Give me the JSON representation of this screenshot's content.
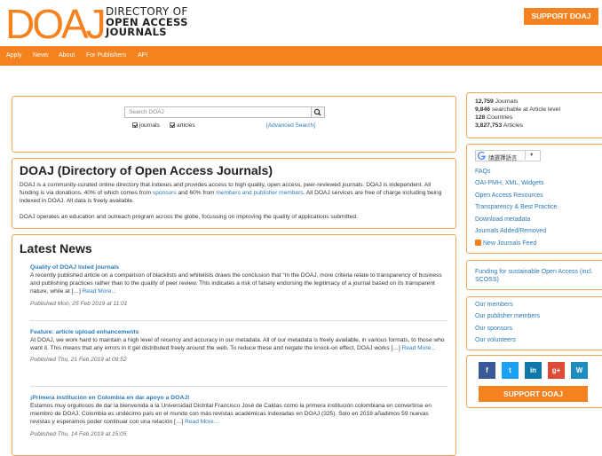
{
  "header": {
    "logo_mark": "DOAJ",
    "logo_line1": "DIRECTORY OF",
    "logo_line2": "OPEN ACCESS",
    "logo_line3": "JOURNALS",
    "support_label": "SUPPORT DOAJ"
  },
  "nav": [
    "Apply",
    "News",
    "About",
    "For Publishers",
    "API"
  ],
  "search": {
    "placeholder": "Search DOAJ",
    "journals_label": "journals",
    "articles_label": "articles",
    "advanced_label": "[Advanced Search]"
  },
  "intro": {
    "title": "DOAJ (Directory of Open Access Journals)",
    "p1_a": "DOAJ is a community-curated online directory that indexes and provides access to high quality, open access, peer-reviewed journals. DOAJ is independent. All funding is via donations, 40% of which comes from ",
    "p1_link1": "sponsors",
    "p1_b": " and 60% from ",
    "p1_link2": "members and publisher members",
    "p1_c": ". All DOAJ services are free of charge including being indexed in DOAJ. All data is freely available.",
    "p2": "DOAJ operates an education and outreach program across the globe, focussing on improving the quality of applications submitted."
  },
  "news": {
    "heading": "Latest News",
    "items": [
      {
        "title": "Quality of DOAJ listed journals",
        "body": "A recently published article on a comparison of blacklists and whitelists draws the conclusion that “In the DOAJ, more criteria relate to transparency of business and publishing practices rather than to the quality of peer review. This indicates a risk of falsely endorsing the legitimacy of a journal based on its transparent nature, while at […] ",
        "more": "Read More...",
        "published": "Published Mon, 25 Feb 2019 at 11:01"
      },
      {
        "title": "Feature: article upload enhancements",
        "body": "At DOAJ, we work hard to maintain a high level of recency and accuracy in our metadata. All of our metadata is freely available, in various formats, to those who want it. This means that any errors in it get distributed freely around the web. To reduce these and negate the knock-on effect, DOAJ works […] ",
        "more": "Read More...",
        "published": "Published Thu, 21 Feb 2019 at 09:52"
      },
      {
        "title": "¡Primera institución en Colombia en dar apoyo a DOAJ!",
        "body": "Estamos muy orgullosos de dar la bienvenida a la Universidad Distrital Francisco José de Caldas como la primera institución colombiana en convertirse en miembro de DOAJ. Colombia es undécimo país en el mundo con más revistas académicas indexadas en DOAJ (325). Solo en 2018 añadimos 59 nuevas revistas y esperamos poder continuar con una relación […] ",
        "more": "Read More...",
        "published": "Published Thu, 14 Feb 2019 at 15:05"
      }
    ]
  },
  "stats": {
    "journals_num": "12,759",
    "journals_label": " Journals",
    "searchable_num": "9,846",
    "searchable_label": " searchable at Article level",
    "countries_num": "128",
    "countries_label": " Countries",
    "articles_num": "3,827,753",
    "articles_label": " Articles"
  },
  "translate": {
    "label": "請選擇語言",
    "arrow": "▼",
    "icon": "google-g-icon"
  },
  "links": [
    "FAQs",
    "OAI-PMH, XML, Widgets",
    "Open Access Resources",
    "Transparency & Best Practice",
    "Download metadata",
    "Journals Added/Removed",
    "New Journals Feed"
  ],
  "funding": "Funding for sustainable Open Access (incl. SCOSS)",
  "members": [
    "Our members",
    "Our publisher members",
    "Our sponsors",
    "Our volunteers"
  ],
  "social": [
    {
      "name": "facebook",
      "glyph": "f",
      "color": "#3b5998"
    },
    {
      "name": "twitter",
      "glyph": "t",
      "color": "#1da1f2"
    },
    {
      "name": "linkedin",
      "glyph": "in",
      "color": "#0e76a8"
    },
    {
      "name": "google-plus",
      "glyph": "g+",
      "color": "#dd4b39"
    },
    {
      "name": "wordpress",
      "glyph": "W",
      "color": "#1e8cbe"
    }
  ],
  "support_bottom": "SUPPORT DOAJ",
  "colors": {
    "accent": "#f6821f",
    "link": "#2a7ab8",
    "border": "#f6a35e"
  }
}
